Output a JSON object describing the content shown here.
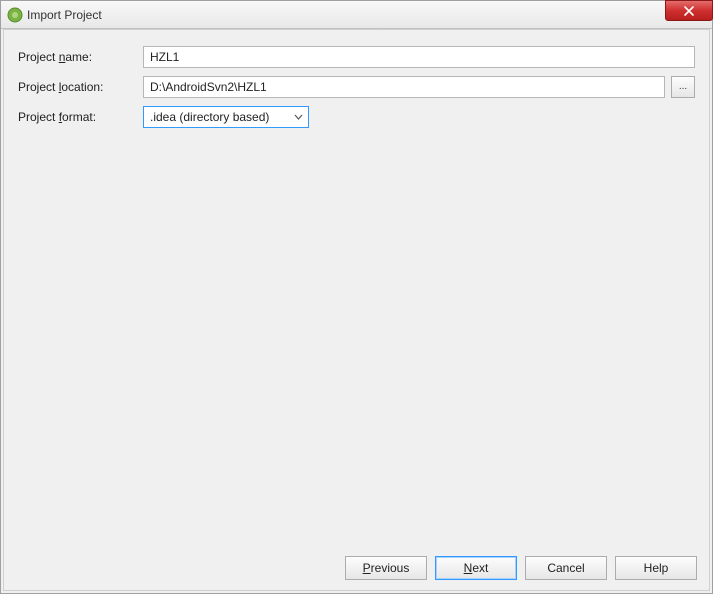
{
  "window": {
    "title": "Import Project"
  },
  "form": {
    "project_name": {
      "label_pre": "Project ",
      "label_mn": "n",
      "label_post": "ame:",
      "value": "HZL1"
    },
    "project_location": {
      "label_pre": "Project ",
      "label_mn": "l",
      "label_post": "ocation:",
      "value": "D:\\AndroidSvn2\\HZL1",
      "browse": "..."
    },
    "project_format": {
      "label_pre": "Project ",
      "label_mn": "f",
      "label_post": "ormat:",
      "value": ".idea (directory based)"
    }
  },
  "buttons": {
    "previous": {
      "pre": "",
      "mn": "P",
      "post": "revious"
    },
    "next": {
      "pre": "",
      "mn": "N",
      "post": "ext"
    },
    "cancel": {
      "text": "Cancel"
    },
    "help": {
      "text": "Help"
    }
  }
}
